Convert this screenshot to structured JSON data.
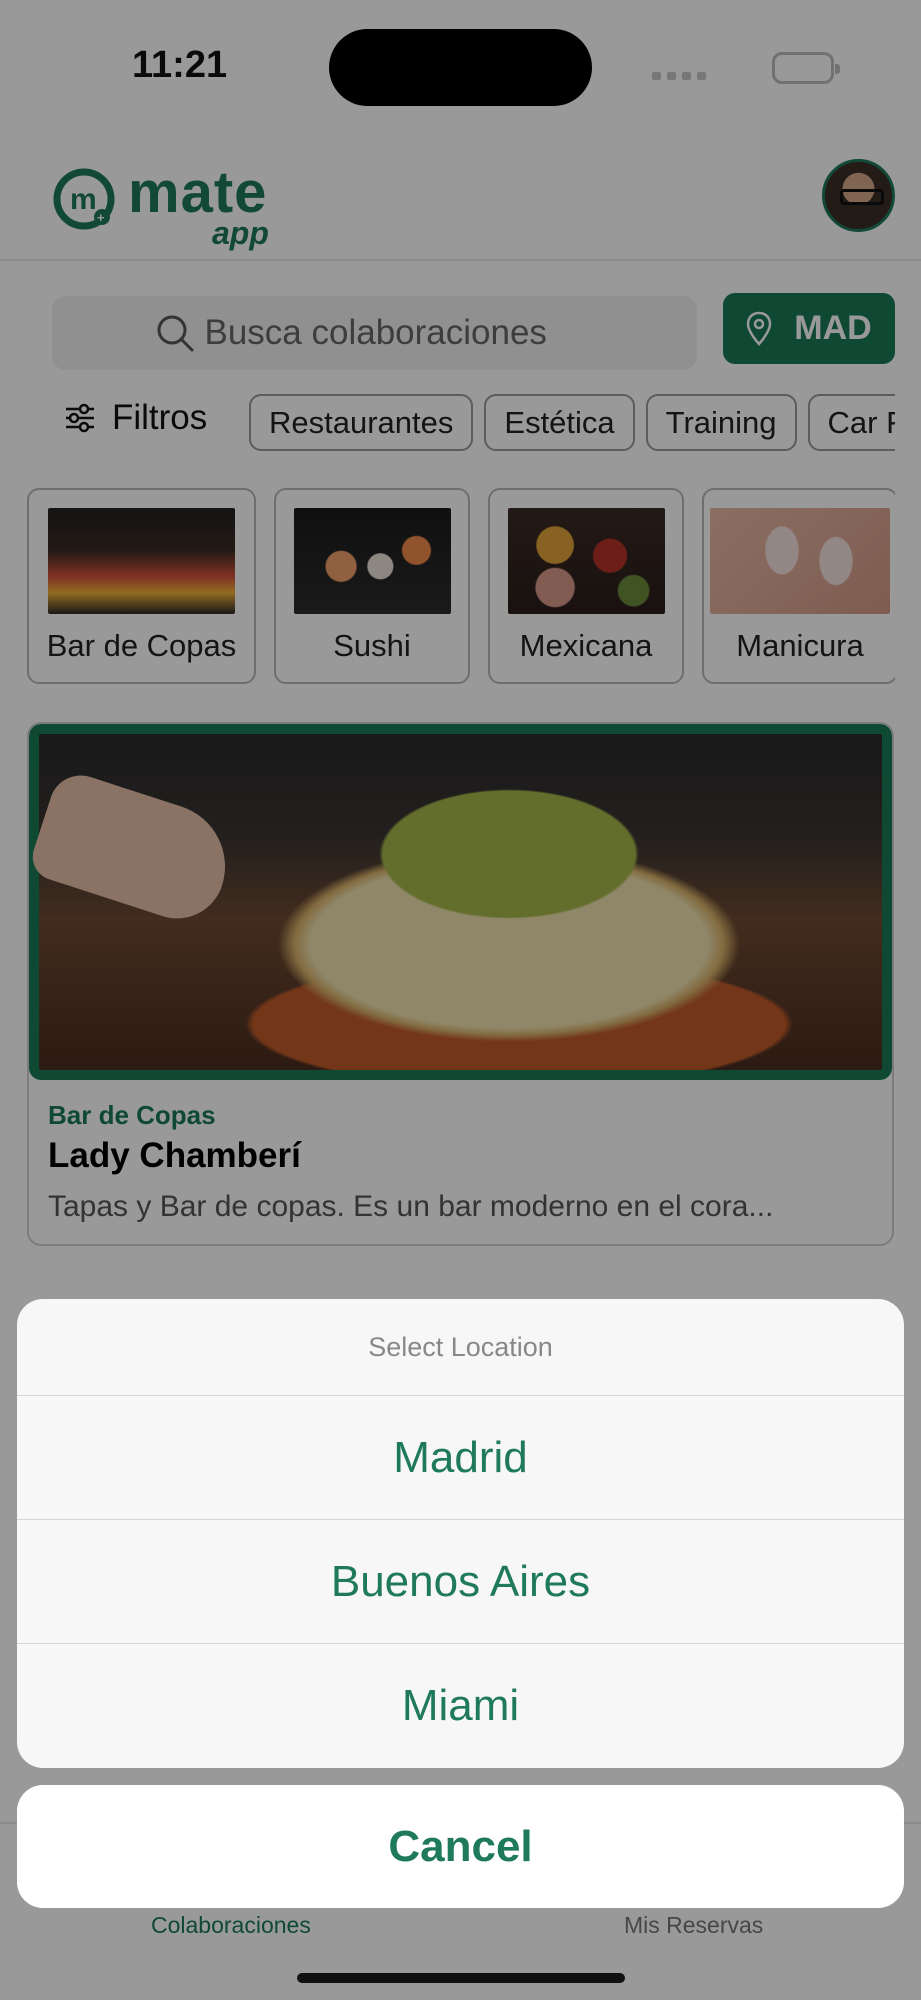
{
  "status_bar": {
    "time": "11:21"
  },
  "header": {
    "logo_word": "mate",
    "logo_sub": "app",
    "avatar_icon": "user-avatar"
  },
  "search": {
    "placeholder": "Busca colaboraciones",
    "location_code": "MAD"
  },
  "filters": {
    "label": "Filtros",
    "chips": [
      "Restaurantes",
      "Estética",
      "Training",
      "Car F"
    ]
  },
  "categories": [
    {
      "label": "Bar de Copas",
      "image": "cocktails-photo"
    },
    {
      "label": "Sushi",
      "image": "sushi-photo"
    },
    {
      "label": "Mexicana",
      "image": "mexican-food-photo"
    },
    {
      "label": "Manicura",
      "image": "manicure-photo"
    }
  ],
  "featured": {
    "category": "Bar de Copas",
    "title": "Lady Chamberí",
    "description": "Tapas y Bar de copas. Es un bar moderno en el cora..."
  },
  "tabs": {
    "collaborations": "Colaboraciones",
    "reservations": "Mis Reservas"
  },
  "action_sheet": {
    "title": "Select Location",
    "options": [
      "Madrid",
      "Buenos Aires",
      "Miami"
    ],
    "cancel": "Cancel"
  },
  "colors": {
    "brand": "#1a7a57",
    "overlay": "rgba(0,0,0,0.40)"
  }
}
